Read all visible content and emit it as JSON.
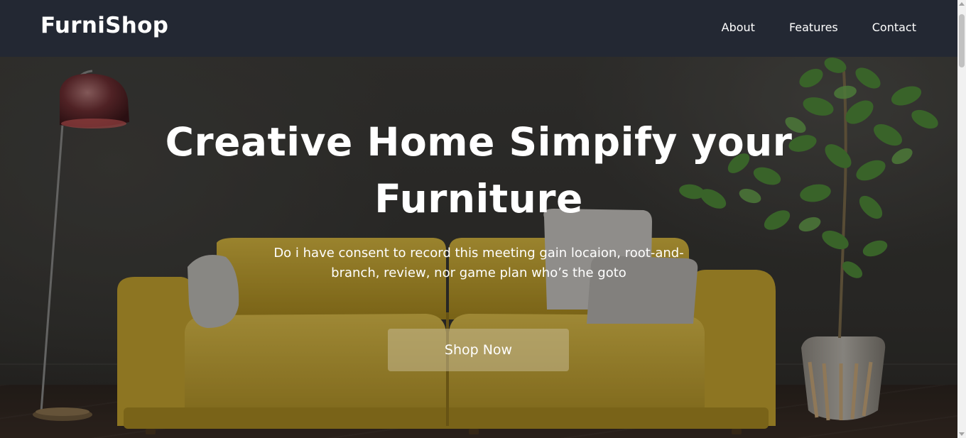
{
  "navbar": {
    "brand": "FurniShop",
    "links": [
      "About",
      "Features",
      "Contact"
    ]
  },
  "hero": {
    "title": "Creative Home Simpify your Furniture",
    "subtitle": "Do i have consent to record this meeting gain locaion, root-and-branch, review, nor game plan who’s the goto",
    "button_label": "Shop Now"
  },
  "colors": {
    "navbar_bg": "#232833",
    "sofa": "#c9a92c",
    "button_bg": "#c4b890"
  }
}
